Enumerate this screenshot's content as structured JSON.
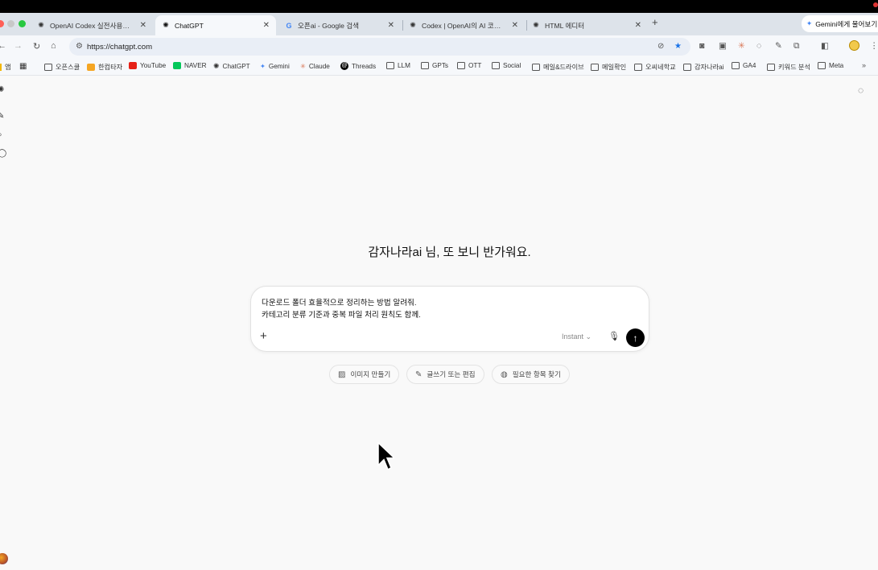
{
  "browser": {
    "tabs": [
      {
        "title": "OpenAI Codex 실전사용법 — 윤",
        "icon": "openai-icon",
        "active": false
      },
      {
        "title": "ChatGPT",
        "icon": "chatgpt-icon",
        "active": true
      },
      {
        "title": "오픈ai - Google 검색",
        "icon": "google-icon",
        "active": false
      },
      {
        "title": "Codex | OpenAI의 AI 코딩 파트",
        "icon": "openai-icon",
        "active": false
      },
      {
        "title": "HTML 에디터",
        "icon": "openai-icon",
        "active": false
      }
    ],
    "new_tab_label": "+",
    "gemini_button": "Gemini에게 물어보기",
    "url": "https://chatgpt.com",
    "bookmarks": [
      {
        "label": "앱",
        "icon": "apps-icon"
      },
      {
        "label": "",
        "icon": "grid-icon"
      },
      {
        "label": "오픈스쿨",
        "icon": "folder-icon"
      },
      {
        "label": "한컴타자",
        "icon": "hancom-icon"
      },
      {
        "label": "YouTube",
        "icon": "youtube-icon"
      },
      {
        "label": "NAVER",
        "icon": "naver-icon"
      },
      {
        "label": "ChatGPT",
        "icon": "chatgpt-icon"
      },
      {
        "label": "Gemini",
        "icon": "gemini-icon"
      },
      {
        "label": "Claude",
        "icon": "claude-icon"
      },
      {
        "label": "Threads",
        "icon": "threads-icon"
      },
      {
        "label": "LLM",
        "icon": "folder-icon"
      },
      {
        "label": "GPTs",
        "icon": "folder-icon"
      },
      {
        "label": "OTT",
        "icon": "folder-icon"
      },
      {
        "label": "Social",
        "icon": "folder-icon"
      },
      {
        "label": "메일&드라이브",
        "icon": "folder-icon"
      },
      {
        "label": "메일확인",
        "icon": "folder-icon"
      },
      {
        "label": "오씨네학교",
        "icon": "folder-icon"
      },
      {
        "label": "감자나라ai",
        "icon": "folder-icon"
      },
      {
        "label": "GA4",
        "icon": "folder-icon"
      },
      {
        "label": "키워드 분석",
        "icon": "folder-icon"
      },
      {
        "label": "Meta",
        "icon": "folder-icon"
      }
    ],
    "more_bookmarks": "»"
  },
  "chat": {
    "greeting": "감자나라ai 님, 또 보니 반가워요.",
    "composer": {
      "line1": "다운로드 폴더 효율적으로 정리하는 방법 알려줘.",
      "line2": "카테고리 분류 기준과 중복 파일 처리 원칙도 함께.",
      "model": "Instant",
      "plus": "+"
    },
    "chips": [
      {
        "label": "이미지 만들기",
        "icon": "image-icon"
      },
      {
        "label": "글쓰기 또는 편집",
        "icon": "pencil-icon"
      },
      {
        "label": "필요한 항목 찾기",
        "icon": "globe-icon"
      }
    ]
  },
  "colors": {
    "tabstrip": "#dde3ea",
    "toolbar": "#f6f8fb",
    "page_bg": "#f9f9f9",
    "send_button": "#000000",
    "star": "#1a73e8"
  }
}
